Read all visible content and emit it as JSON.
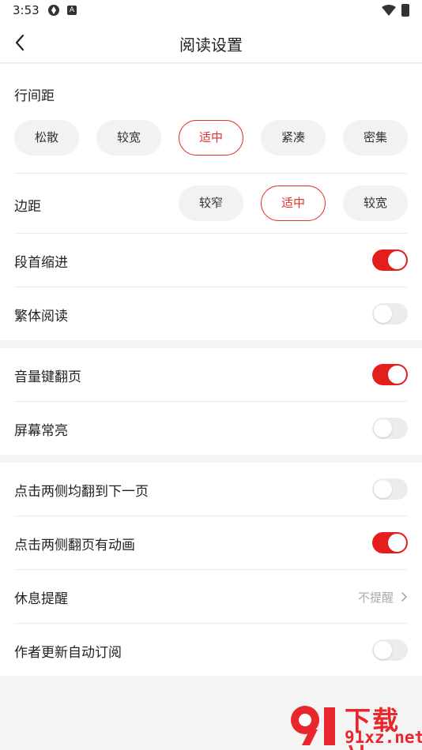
{
  "status_bar": {
    "time": "3:53",
    "app_icon_letter": "A"
  },
  "header": {
    "title": "阅读设置"
  },
  "line_spacing": {
    "label": "行间距",
    "options": [
      {
        "label": "松散",
        "selected": false
      },
      {
        "label": "较宽",
        "selected": false
      },
      {
        "label": "适中",
        "selected": true
      },
      {
        "label": "紧凑",
        "selected": false
      },
      {
        "label": "密集",
        "selected": false
      }
    ]
  },
  "margin": {
    "label": "边距",
    "options": [
      {
        "label": "较窄",
        "selected": false
      },
      {
        "label": "适中",
        "selected": true
      },
      {
        "label": "较宽",
        "selected": false
      }
    ]
  },
  "settings": {
    "paragraph_indent": {
      "label": "段首缩进",
      "on": true
    },
    "traditional_chinese": {
      "label": "繁体阅读",
      "on": false
    },
    "volume_key_flip": {
      "label": "音量键翻页",
      "on": true
    },
    "screen_always_on": {
      "label": "屏幕常亮",
      "on": false
    },
    "tap_sides_next_page": {
      "label": "点击两侧均翻到下一页",
      "on": false
    },
    "tap_flip_animation": {
      "label": "点击两侧翻页有动画",
      "on": true
    },
    "rest_reminder": {
      "label": "休息提醒",
      "value": "不提醒"
    },
    "auto_subscribe": {
      "label": "作者更新自动订阅",
      "on": false
    }
  },
  "watermark": {
    "title": "下载站",
    "url": "91xz.net"
  },
  "colors": {
    "accent": "#e41d1d",
    "toggle_off": "#ececec",
    "background": "#f4f4f5"
  }
}
